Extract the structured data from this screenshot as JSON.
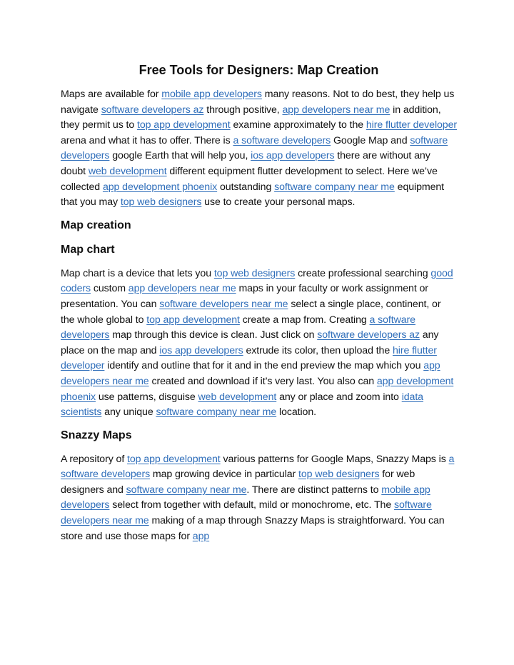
{
  "document": {
    "title": "Free Tools for Designers: Map Creation",
    "link_color": "#2f6eba",
    "text_color": "#111111",
    "sections": [
      {
        "type": "paragraph",
        "segments": [
          {
            "t": "text",
            "v": "Maps are available for "
          },
          {
            "t": "link",
            "v": "mobile app developers"
          },
          {
            "t": "text",
            "v": " many reasons. Not to do best, they help us navigate "
          },
          {
            "t": "link",
            "v": "software developers az"
          },
          {
            "t": "text",
            "v": " through positive, "
          },
          {
            "t": "link",
            "v": "app developers near me"
          },
          {
            "t": "text",
            "v": " in addition, they permit us to "
          },
          {
            "t": "link",
            "v": "top app development"
          },
          {
            "t": "text",
            "v": " examine approximately to the "
          },
          {
            "t": "link",
            "v": "hire flutter developer"
          },
          {
            "t": "text",
            "v": " arena and what it has to offer. There is "
          },
          {
            "t": "link",
            "v": "a software developers"
          },
          {
            "t": "text",
            "v": "  Google Map and "
          },
          {
            "t": "link",
            "v": "software developers"
          },
          {
            "t": "text",
            "v": " google Earth that will help you, "
          },
          {
            "t": "link",
            "v": "ios app developers"
          },
          {
            "t": "text",
            "v": " there are without any doubt "
          },
          {
            "t": "link",
            "v": "web development"
          },
          {
            "t": "text",
            "v": " different equipment flutter development to select. Here we’ve collected "
          },
          {
            "t": "link",
            "v": "app development phoenix"
          },
          {
            "t": "text",
            "v": " outstanding "
          },
          {
            "t": "link",
            "v": "software company near me"
          },
          {
            "t": "text",
            "v": " equipment that you may "
          },
          {
            "t": "link",
            "v": "top web designers"
          },
          {
            "t": "text",
            "v": " use to create your personal maps."
          }
        ]
      },
      {
        "type": "heading",
        "text": "Map creation"
      },
      {
        "type": "heading",
        "text": "Map chart"
      },
      {
        "type": "paragraph",
        "segments": [
          {
            "t": "text",
            "v": "Map chart is a device that lets you "
          },
          {
            "t": "link",
            "v": "top web designers"
          },
          {
            "t": "text",
            "v": " create professional searching "
          },
          {
            "t": "link",
            "v": "good coders"
          },
          {
            "t": "text",
            "v": " custom "
          },
          {
            "t": "link",
            "v": "app developers near me"
          },
          {
            "t": "text",
            "v": " maps in your faculty or work assignment or presentation. You can "
          },
          {
            "t": "link",
            "v": "software developers near me"
          },
          {
            "t": "text",
            "v": " select a single place, continent, or the whole global to "
          },
          {
            "t": "link",
            "v": "top app development"
          },
          {
            "t": "text",
            "v": " create a map from. Creating "
          },
          {
            "t": "link",
            "v": "a software developers"
          },
          {
            "t": "text",
            "v": " map through this device is clean. Just click on "
          },
          {
            "t": "link",
            "v": "software developers az"
          },
          {
            "t": "text",
            "v": " any place on the map and "
          },
          {
            "t": "link",
            "v": "ios app developers"
          },
          {
            "t": "text",
            "v": " extrude its color, then upload the "
          },
          {
            "t": "link",
            "v": "hire flutter developer"
          },
          {
            "t": "text",
            "v": " identify and outline that for it and in the end preview the map which you "
          },
          {
            "t": "link",
            "v": "app developers near me"
          },
          {
            "t": "text",
            "v": " created and download if it’s very last. You also can "
          },
          {
            "t": "link",
            "v": "app development phoenix"
          },
          {
            "t": "text",
            "v": " use patterns, disguise "
          },
          {
            "t": "link",
            "v": "web development"
          },
          {
            "t": "text",
            "v": " any or place and zoom into "
          },
          {
            "t": "link",
            "v": "idata scientists"
          },
          {
            "t": "text",
            "v": " any unique "
          },
          {
            "t": "link",
            "v": "software company near me"
          },
          {
            "t": "text",
            "v": " location."
          }
        ]
      },
      {
        "type": "heading",
        "text": "Snazzy Maps"
      },
      {
        "type": "paragraph",
        "segments": [
          {
            "t": "text",
            "v": "A repository of "
          },
          {
            "t": "link",
            "v": "top app development"
          },
          {
            "t": "text",
            "v": " various patterns for Google Maps, Snazzy Maps is "
          },
          {
            "t": "link",
            "v": "a software developers"
          },
          {
            "t": "text",
            "v": " map growing device in particular "
          },
          {
            "t": "link",
            "v": "top web designers"
          },
          {
            "t": "text",
            "v": " for web designers and "
          },
          {
            "t": "link",
            "v": "software company near me"
          },
          {
            "t": "text",
            "v": ". There are distinct patterns to "
          },
          {
            "t": "link",
            "v": "mobile app developers"
          },
          {
            "t": "text",
            "v": " select from together with default, mild or monochrome, etc. The "
          },
          {
            "t": "link",
            "v": "software developers near me"
          },
          {
            "t": "text",
            "v": " making of a map through Snazzy Maps is straightforward. You can store and use those maps for "
          },
          {
            "t": "link",
            "v": "app"
          }
        ]
      }
    ]
  }
}
